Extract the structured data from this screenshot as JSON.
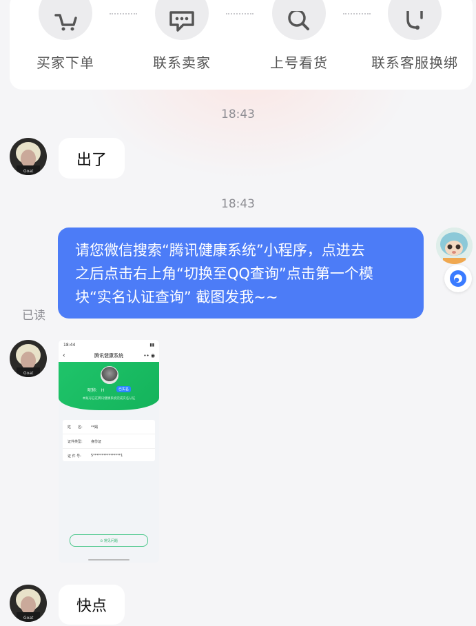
{
  "steps": [
    {
      "label": "买家下单",
      "icon": "cart-icon"
    },
    {
      "label": "联系卖家",
      "icon": "chat-icon"
    },
    {
      "label": "上号看货",
      "icon": "search-icon"
    },
    {
      "label": "联系客服换绑",
      "icon": "headset-icon"
    }
  ],
  "messages": [
    {
      "time": "18:43",
      "text": "出了",
      "side": "left"
    },
    {
      "time": "18:43",
      "side": "right",
      "lines": [
        "请您微信搜索“腾讯健康系统”小程序，点进去",
        "之后点击右上角“切换至QQ查询”点击第一个模",
        "块“实名认证查询” 截图发我~~"
      ],
      "status": "已读"
    },
    {
      "side": "left",
      "type": "image"
    },
    {
      "text": "快点",
      "side": "left"
    }
  ],
  "screenshot": {
    "status_time": "18:44",
    "nav_title": "腾讯健康系统",
    "nickname_label": "昵称:",
    "nickname_value": "H",
    "verified_badge": "已实名",
    "subtitle": "本账号已在腾讯健康系统完成实名认证",
    "rows": [
      {
        "key": "姓　　名:",
        "value": "**娟"
      },
      {
        "key": "证件类型:",
        "value": "身份证"
      },
      {
        "key": "证 件 号:",
        "value": "5****************1"
      }
    ],
    "faq_label": "⊙ 常见问题"
  },
  "colors": {
    "accent": "#4c7cf7",
    "green": "#1fc46a",
    "background": "#f5f5f7"
  }
}
